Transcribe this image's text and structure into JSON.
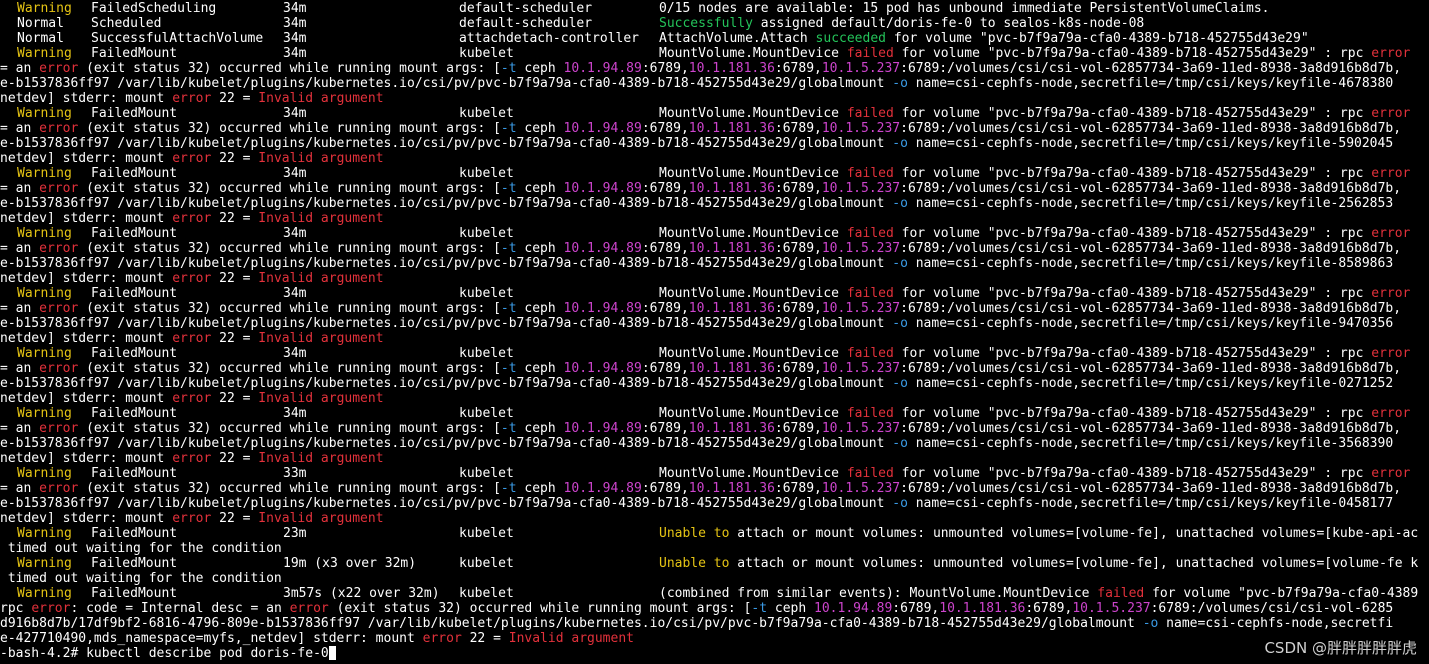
{
  "theme": {
    "background": "#000000",
    "colors": {
      "w": "#ffffff",
      "y": "#e5c414",
      "r": "#e2313b",
      "m": "#cc44cc",
      "b": "#3a9ae5",
      "g": "#24c45a"
    }
  },
  "columns": {
    "type": 17,
    "reason": 91,
    "age": 283,
    "from": 459,
    "message": 659
  },
  "lines": [
    {
      "type": {
        "text": "Warning",
        "color": "y"
      },
      "reason": "FailedScheduling",
      "age": "34m",
      "from": "default-scheduler",
      "message": [
        [
          "0/15 nodes are available: 15 pod has unbound immediate PersistentVolumeClaims.",
          "w"
        ]
      ]
    },
    {
      "type": {
        "text": "Normal",
        "color": "w"
      },
      "reason": "Scheduled",
      "age": "34m",
      "from": "default-scheduler",
      "message": [
        [
          "Successfully",
          "g"
        ],
        [
          " assigned default/doris-fe-0 to sealos-k8s-node-08",
          "w"
        ]
      ]
    },
    {
      "type": {
        "text": "Normal",
        "color": "w"
      },
      "reason": "SuccessfulAttachVolume",
      "age": "34m",
      "from": "attachdetach-controller",
      "message": [
        [
          "AttachVolume.Attach ",
          "w"
        ],
        [
          "succeeded",
          "g"
        ],
        [
          " for volume \"pvc-b7f9a79a-cfa0-4389-b718-452755d43e29\"",
          "w"
        ]
      ]
    },
    {
      "type": {
        "text": "Warning",
        "color": "y"
      },
      "reason": "FailedMount",
      "age": "34m",
      "from": "kubelet",
      "message": [
        [
          "MountVolume.MountDevice ",
          "w"
        ],
        [
          "failed",
          "r"
        ],
        [
          " for volume \"pvc-b7f9a79a-cfa0-4389-b718-452755d43e29\" : rpc ",
          "w"
        ],
        [
          "error",
          "r"
        ]
      ]
    },
    {
      "segments": [
        [
          "= an ",
          "w"
        ],
        [
          "error",
          "r"
        ],
        [
          " (exit status 32) occurred while running mount args: [",
          "w"
        ],
        [
          "-t",
          "b"
        ],
        [
          " ceph ",
          "w"
        ],
        [
          "10.1.94.89",
          "m"
        ],
        [
          ":6789,",
          "w"
        ],
        [
          "10.1.181.36",
          "m"
        ],
        [
          ":6789,",
          "w"
        ],
        [
          "10.1.5.237",
          "m"
        ],
        [
          ":6789:/volumes/csi/csi-vol-62857734-3a69-11ed-8938-3a8d916b8d7b,",
          "w"
        ]
      ]
    },
    {
      "segments": [
        [
          "e-b1537836ff97 /var/lib/kubelet/plugins/kubernetes.io/csi/pv/pvc-b7f9a79a-cfa0-4389-b718-452755d43e29/globalmount ",
          "w"
        ],
        [
          "-o",
          "b"
        ],
        [
          " name=csi-cephfs-node,secretfile=/tmp/csi/keys/keyfile-4678380",
          "w"
        ]
      ]
    },
    {
      "segments": [
        [
          "netdev] stderr: mount ",
          "w"
        ],
        [
          "error",
          "r"
        ],
        [
          " 22 = ",
          "w"
        ],
        [
          "Invalid argument",
          "r"
        ]
      ]
    },
    {
      "type": {
        "text": "Warning",
        "color": "y"
      },
      "reason": "FailedMount",
      "age": "34m",
      "from": "kubelet",
      "message": [
        [
          "MountVolume.MountDevice ",
          "w"
        ],
        [
          "failed",
          "r"
        ],
        [
          " for volume \"pvc-b7f9a79a-cfa0-4389-b718-452755d43e29\" : rpc ",
          "w"
        ],
        [
          "error",
          "r"
        ]
      ]
    },
    {
      "segments": [
        [
          "= an ",
          "w"
        ],
        [
          "error",
          "r"
        ],
        [
          " (exit status 32) occurred while running mount args: [",
          "w"
        ],
        [
          "-t",
          "b"
        ],
        [
          " ceph ",
          "w"
        ],
        [
          "10.1.94.89",
          "m"
        ],
        [
          ":6789,",
          "w"
        ],
        [
          "10.1.181.36",
          "m"
        ],
        [
          ":6789,",
          "w"
        ],
        [
          "10.1.5.237",
          "m"
        ],
        [
          ":6789:/volumes/csi/csi-vol-62857734-3a69-11ed-8938-3a8d916b8d7b,",
          "w"
        ]
      ]
    },
    {
      "segments": [
        [
          "e-b1537836ff97 /var/lib/kubelet/plugins/kubernetes.io/csi/pv/pvc-b7f9a79a-cfa0-4389-b718-452755d43e29/globalmount ",
          "w"
        ],
        [
          "-o",
          "b"
        ],
        [
          " name=csi-cephfs-node,secretfile=/tmp/csi/keys/keyfile-5902045",
          "w"
        ]
      ]
    },
    {
      "segments": [
        [
          "netdev] stderr: mount ",
          "w"
        ],
        [
          "error",
          "r"
        ],
        [
          " 22 = ",
          "w"
        ],
        [
          "Invalid argument",
          "r"
        ]
      ]
    },
    {
      "type": {
        "text": "Warning",
        "color": "y"
      },
      "reason": "FailedMount",
      "age": "34m",
      "from": "kubelet",
      "message": [
        [
          "MountVolume.MountDevice ",
          "w"
        ],
        [
          "failed",
          "r"
        ],
        [
          " for volume \"pvc-b7f9a79a-cfa0-4389-b718-452755d43e29\" : rpc ",
          "w"
        ],
        [
          "error",
          "r"
        ]
      ]
    },
    {
      "segments": [
        [
          "= an ",
          "w"
        ],
        [
          "error",
          "r"
        ],
        [
          " (exit status 32) occurred while running mount args: [",
          "w"
        ],
        [
          "-t",
          "b"
        ],
        [
          " ceph ",
          "w"
        ],
        [
          "10.1.94.89",
          "m"
        ],
        [
          ":6789,",
          "w"
        ],
        [
          "10.1.181.36",
          "m"
        ],
        [
          ":6789,",
          "w"
        ],
        [
          "10.1.5.237",
          "m"
        ],
        [
          ":6789:/volumes/csi/csi-vol-62857734-3a69-11ed-8938-3a8d916b8d7b,",
          "w"
        ]
      ]
    },
    {
      "segments": [
        [
          "e-b1537836ff97 /var/lib/kubelet/plugins/kubernetes.io/csi/pv/pvc-b7f9a79a-cfa0-4389-b718-452755d43e29/globalmount ",
          "w"
        ],
        [
          "-o",
          "b"
        ],
        [
          " name=csi-cephfs-node,secretfile=/tmp/csi/keys/keyfile-2562853",
          "w"
        ]
      ]
    },
    {
      "segments": [
        [
          "netdev] stderr: mount ",
          "w"
        ],
        [
          "error",
          "r"
        ],
        [
          " 22 = ",
          "w"
        ],
        [
          "Invalid argument",
          "r"
        ]
      ]
    },
    {
      "type": {
        "text": "Warning",
        "color": "y"
      },
      "reason": "FailedMount",
      "age": "34m",
      "from": "kubelet",
      "message": [
        [
          "MountVolume.MountDevice ",
          "w"
        ],
        [
          "failed",
          "r"
        ],
        [
          " for volume \"pvc-b7f9a79a-cfa0-4389-b718-452755d43e29\" : rpc ",
          "w"
        ],
        [
          "error",
          "r"
        ]
      ]
    },
    {
      "segments": [
        [
          "= an ",
          "w"
        ],
        [
          "error",
          "r"
        ],
        [
          " (exit status 32) occurred while running mount args: [",
          "w"
        ],
        [
          "-t",
          "b"
        ],
        [
          " ceph ",
          "w"
        ],
        [
          "10.1.94.89",
          "m"
        ],
        [
          ":6789,",
          "w"
        ],
        [
          "10.1.181.36",
          "m"
        ],
        [
          ":6789,",
          "w"
        ],
        [
          "10.1.5.237",
          "m"
        ],
        [
          ":6789:/volumes/csi/csi-vol-62857734-3a69-11ed-8938-3a8d916b8d7b,",
          "w"
        ]
      ]
    },
    {
      "segments": [
        [
          "e-b1537836ff97 /var/lib/kubelet/plugins/kubernetes.io/csi/pv/pvc-b7f9a79a-cfa0-4389-b718-452755d43e29/globalmount ",
          "w"
        ],
        [
          "-o",
          "b"
        ],
        [
          " name=csi-cephfs-node,secretfile=/tmp/csi/keys/keyfile-8589863",
          "w"
        ]
      ]
    },
    {
      "segments": [
        [
          "netdev] stderr: mount ",
          "w"
        ],
        [
          "error",
          "r"
        ],
        [
          " 22 = ",
          "w"
        ],
        [
          "Invalid argument",
          "r"
        ]
      ]
    },
    {
      "type": {
        "text": "Warning",
        "color": "y"
      },
      "reason": "FailedMount",
      "age": "34m",
      "from": "kubelet",
      "message": [
        [
          "MountVolume.MountDevice ",
          "w"
        ],
        [
          "failed",
          "r"
        ],
        [
          " for volume \"pvc-b7f9a79a-cfa0-4389-b718-452755d43e29\" : rpc ",
          "w"
        ],
        [
          "error",
          "r"
        ]
      ]
    },
    {
      "segments": [
        [
          "= an ",
          "w"
        ],
        [
          "error",
          "r"
        ],
        [
          " (exit status 32) occurred while running mount args: [",
          "w"
        ],
        [
          "-t",
          "b"
        ],
        [
          " ceph ",
          "w"
        ],
        [
          "10.1.94.89",
          "m"
        ],
        [
          ":6789,",
          "w"
        ],
        [
          "10.1.181.36",
          "m"
        ],
        [
          ":6789,",
          "w"
        ],
        [
          "10.1.5.237",
          "m"
        ],
        [
          ":6789:/volumes/csi/csi-vol-62857734-3a69-11ed-8938-3a8d916b8d7b,",
          "w"
        ]
      ]
    },
    {
      "segments": [
        [
          "e-b1537836ff97 /var/lib/kubelet/plugins/kubernetes.io/csi/pv/pvc-b7f9a79a-cfa0-4389-b718-452755d43e29/globalmount ",
          "w"
        ],
        [
          "-o",
          "b"
        ],
        [
          " name=csi-cephfs-node,secretfile=/tmp/csi/keys/keyfile-9470356",
          "w"
        ]
      ]
    },
    {
      "segments": [
        [
          "netdev] stderr: mount ",
          "w"
        ],
        [
          "error",
          "r"
        ],
        [
          " 22 = ",
          "w"
        ],
        [
          "Invalid argument",
          "r"
        ]
      ]
    },
    {
      "type": {
        "text": "Warning",
        "color": "y"
      },
      "reason": "FailedMount",
      "age": "34m",
      "from": "kubelet",
      "message": [
        [
          "MountVolume.MountDevice ",
          "w"
        ],
        [
          "failed",
          "r"
        ],
        [
          " for volume \"pvc-b7f9a79a-cfa0-4389-b718-452755d43e29\" : rpc ",
          "w"
        ],
        [
          "error",
          "r"
        ]
      ]
    },
    {
      "segments": [
        [
          "= an ",
          "w"
        ],
        [
          "error",
          "r"
        ],
        [
          " (exit status 32) occurred while running mount args: [",
          "w"
        ],
        [
          "-t",
          "b"
        ],
        [
          " ceph ",
          "w"
        ],
        [
          "10.1.94.89",
          "m"
        ],
        [
          ":6789,",
          "w"
        ],
        [
          "10.1.181.36",
          "m"
        ],
        [
          ":6789,",
          "w"
        ],
        [
          "10.1.5.237",
          "m"
        ],
        [
          ":6789:/volumes/csi/csi-vol-62857734-3a69-11ed-8938-3a8d916b8d7b,",
          "w"
        ]
      ]
    },
    {
      "segments": [
        [
          "e-b1537836ff97 /var/lib/kubelet/plugins/kubernetes.io/csi/pv/pvc-b7f9a79a-cfa0-4389-b718-452755d43e29/globalmount ",
          "w"
        ],
        [
          "-o",
          "b"
        ],
        [
          " name=csi-cephfs-node,secretfile=/tmp/csi/keys/keyfile-0271252",
          "w"
        ]
      ]
    },
    {
      "segments": [
        [
          "netdev] stderr: mount ",
          "w"
        ],
        [
          "error",
          "r"
        ],
        [
          " 22 = ",
          "w"
        ],
        [
          "Invalid argument",
          "r"
        ]
      ]
    },
    {
      "type": {
        "text": "Warning",
        "color": "y"
      },
      "reason": "FailedMount",
      "age": "34m",
      "from": "kubelet",
      "message": [
        [
          "MountVolume.MountDevice ",
          "w"
        ],
        [
          "failed",
          "r"
        ],
        [
          " for volume \"pvc-b7f9a79a-cfa0-4389-b718-452755d43e29\" : rpc ",
          "w"
        ],
        [
          "error",
          "r"
        ]
      ]
    },
    {
      "segments": [
        [
          "= an ",
          "w"
        ],
        [
          "error",
          "r"
        ],
        [
          " (exit status 32) occurred while running mount args: [",
          "w"
        ],
        [
          "-t",
          "b"
        ],
        [
          " ceph ",
          "w"
        ],
        [
          "10.1.94.89",
          "m"
        ],
        [
          ":6789,",
          "w"
        ],
        [
          "10.1.181.36",
          "m"
        ],
        [
          ":6789,",
          "w"
        ],
        [
          "10.1.5.237",
          "m"
        ],
        [
          ":6789:/volumes/csi/csi-vol-62857734-3a69-11ed-8938-3a8d916b8d7b,",
          "w"
        ]
      ]
    },
    {
      "segments": [
        [
          "e-b1537836ff97 /var/lib/kubelet/plugins/kubernetes.io/csi/pv/pvc-b7f9a79a-cfa0-4389-b718-452755d43e29/globalmount ",
          "w"
        ],
        [
          "-o",
          "b"
        ],
        [
          " name=csi-cephfs-node,secretfile=/tmp/csi/keys/keyfile-3568390",
          "w"
        ]
      ]
    },
    {
      "segments": [
        [
          "netdev] stderr: mount ",
          "w"
        ],
        [
          "error",
          "r"
        ],
        [
          " 22 = ",
          "w"
        ],
        [
          "Invalid argument",
          "r"
        ]
      ]
    },
    {
      "type": {
        "text": "Warning",
        "color": "y"
      },
      "reason": "FailedMount",
      "age": "33m",
      "from": "kubelet",
      "message": [
        [
          "MountVolume.MountDevice ",
          "w"
        ],
        [
          "failed",
          "r"
        ],
        [
          " for volume \"pvc-b7f9a79a-cfa0-4389-b718-452755d43e29\" : rpc ",
          "w"
        ],
        [
          "error",
          "r"
        ]
      ]
    },
    {
      "segments": [
        [
          "= an ",
          "w"
        ],
        [
          "error",
          "r"
        ],
        [
          " (exit status 32) occurred while running mount args: [",
          "w"
        ],
        [
          "-t",
          "b"
        ],
        [
          " ceph ",
          "w"
        ],
        [
          "10.1.94.89",
          "m"
        ],
        [
          ":6789,",
          "w"
        ],
        [
          "10.1.181.36",
          "m"
        ],
        [
          ":6789,",
          "w"
        ],
        [
          "10.1.5.237",
          "m"
        ],
        [
          ":6789:/volumes/csi/csi-vol-62857734-3a69-11ed-8938-3a8d916b8d7b,",
          "w"
        ]
      ]
    },
    {
      "segments": [
        [
          "e-b1537836ff97 /var/lib/kubelet/plugins/kubernetes.io/csi/pv/pvc-b7f9a79a-cfa0-4389-b718-452755d43e29/globalmount ",
          "w"
        ],
        [
          "-o",
          "b"
        ],
        [
          " name=csi-cephfs-node,secretfile=/tmp/csi/keys/keyfile-0458177",
          "w"
        ]
      ]
    },
    {
      "segments": [
        [
          "netdev] stderr: mount ",
          "w"
        ],
        [
          "error",
          "r"
        ],
        [
          " 22 = ",
          "w"
        ],
        [
          "Invalid argument",
          "r"
        ]
      ]
    },
    {
      "type": {
        "text": "Warning",
        "color": "y"
      },
      "reason": "FailedMount",
      "age": "23m",
      "from": "kubelet",
      "message": [
        [
          "Unable to",
          "y"
        ],
        [
          " attach or mount volumes: unmounted volumes=[volume-fe], unattached volumes=[kube-api-ac",
          "w"
        ]
      ]
    },
    {
      "segments": [
        [
          " timed out waiting for the condition",
          "w"
        ]
      ]
    },
    {
      "type": {
        "text": "Warning",
        "color": "y"
      },
      "reason": "FailedMount",
      "age": "19m (x3 over 32m)",
      "from": "kubelet",
      "message": [
        [
          "Unable to",
          "y"
        ],
        [
          " attach or mount volumes: unmounted volumes=[volume-fe], unattached volumes=[volume-fe k",
          "w"
        ]
      ]
    },
    {
      "segments": [
        [
          " timed out waiting for the condition",
          "w"
        ]
      ]
    },
    {
      "type": {
        "text": "Warning",
        "color": "y"
      },
      "reason": "FailedMount",
      "age": "3m57s (x22 over 32m)",
      "from": "kubelet",
      "message": [
        [
          "(combined from similar events): MountVolume.MountDevice ",
          "w"
        ],
        [
          "failed",
          "r"
        ],
        [
          " for volume \"pvc-b7f9a79a-cfa0-4389",
          "w"
        ]
      ]
    },
    {
      "segments": [
        [
          "rpc ",
          "w"
        ],
        [
          "error",
          "r"
        ],
        [
          ": code = Internal desc = an ",
          "w"
        ],
        [
          "error",
          "r"
        ],
        [
          " (exit status 32) occurred while running mount args: [",
          "w"
        ],
        [
          "-t",
          "b"
        ],
        [
          " ceph ",
          "w"
        ],
        [
          "10.1.94.89",
          "m"
        ],
        [
          ":6789,",
          "w"
        ],
        [
          "10.1.181.36",
          "m"
        ],
        [
          ":6789,",
          "w"
        ],
        [
          "10.1.5.237",
          "m"
        ],
        [
          ":6789:/volumes/csi/csi-vol-6285",
          "w"
        ]
      ]
    },
    {
      "segments": [
        [
          "d916b8d7b/17df9bf2-6816-4796-809e-b1537836ff97 /var/lib/kubelet/plugins/kubernetes.io/csi/pv/pvc-b7f9a79a-cfa0-4389-b718-452755d43e29/globalmount ",
          "w"
        ],
        [
          "-o",
          "b"
        ],
        [
          " name=csi-cephfs-node,secretfi",
          "w"
        ]
      ]
    },
    {
      "segments": [
        [
          "e-427710490,mds_namespace=myfs,_netdev] stderr: mount ",
          "w"
        ],
        [
          "error",
          "r"
        ],
        [
          " 22 = ",
          "w"
        ],
        [
          "Invalid argument",
          "r"
        ]
      ]
    },
    {
      "segments": [
        [
          "-bash-4.2# kubectl describe pod doris-fe-0",
          "w"
        ]
      ],
      "cursor": true
    }
  ],
  "watermark": "CSDN @胖胖胖胖胖虎"
}
